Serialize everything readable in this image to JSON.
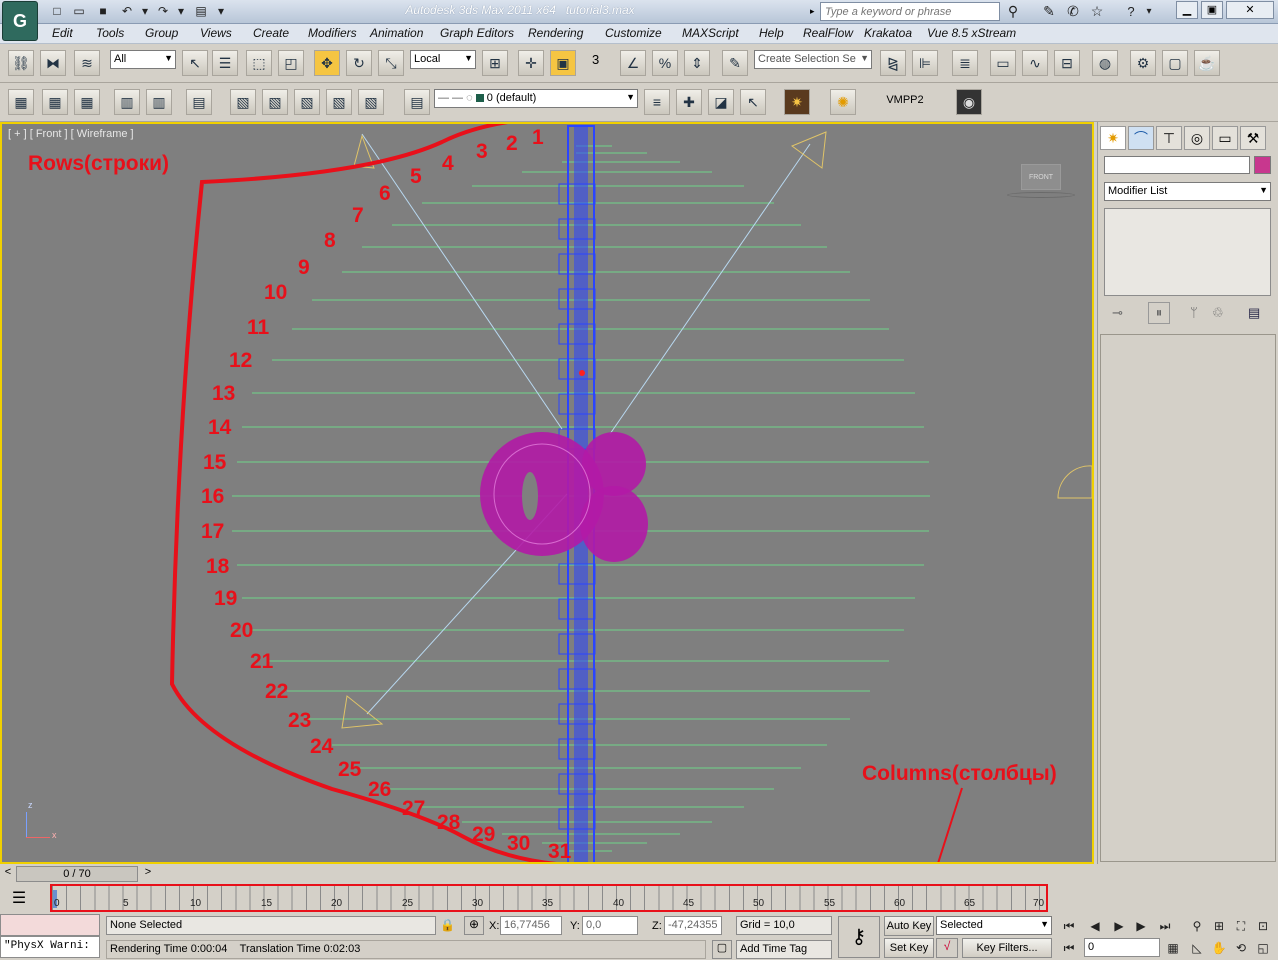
{
  "title": {
    "app": "Autodesk 3ds Max  2011 x64",
    "file": "tutorial3.max",
    "logo_glyph": "G"
  },
  "search": {
    "placeholder": "Type a keyword or phrase"
  },
  "menus": [
    "Edit",
    "Tools",
    "Group",
    "Views",
    "Create",
    "Modifiers",
    "Animation",
    "Graph Editors",
    "Rendering",
    "Customize",
    "MAXScript",
    "Help",
    "RealFlow",
    "Krakatoa",
    "Vue 8.5 xStream"
  ],
  "toolbar": {
    "filter": "All",
    "coord_system": "Local",
    "selection_set_placeholder": "Create Selection Se",
    "snap_number": "3",
    "layer": "0 (default)",
    "vmpp_label": "VMPP2"
  },
  "viewport": {
    "label": "[ + ] [ Front ] [ Wireframe ]",
    "viewcube_label": "FRONT",
    "axis_z": "z",
    "axis_x": "x",
    "annotation_rows": "Rows(строки)",
    "annotation_columns": "Columns(столбцы)",
    "row_numbers": [
      "1",
      "2",
      "3",
      "4",
      "5",
      "6",
      "7",
      "8",
      "9",
      "10",
      "11",
      "12",
      "13",
      "14",
      "15",
      "16",
      "17",
      "18",
      "19",
      "20",
      "21",
      "22",
      "23",
      "24",
      "25",
      "26",
      "27",
      "28",
      "29",
      "30",
      "31"
    ]
  },
  "command_panel": {
    "modifier_list": "Modifier List"
  },
  "timeline": {
    "frame_counter": "0 / 70",
    "prev": "<",
    "next": ">",
    "ticks": [
      "0",
      "5",
      "10",
      "15",
      "20",
      "25",
      "30",
      "35",
      "40",
      "45",
      "50",
      "55",
      "60",
      "65",
      "70"
    ]
  },
  "status": {
    "maxscript_listener": "\"PhysX Warni:",
    "selection": "None Selected",
    "rendering_time": "Rendering Time  0:00:04",
    "translation_time": "Translation Time  0:02:03",
    "x_label": "X:",
    "x_value": "16,77456",
    "y_label": "Y:",
    "y_value": "0,0",
    "z_label": "Z:",
    "z_value": "-47,24355",
    "grid": "Grid = 10,0",
    "add_time_tag": "Add Time Tag",
    "auto_key": "Auto Key",
    "set_key": "Set Key",
    "key_mode": "Selected",
    "key_filters": "Key Filters...",
    "current_frame": "0"
  },
  "colors": {
    "annotation": "#e8101a",
    "grid_lines": "#6fd48a",
    "camera": "#e0c468",
    "mesh": "#b21aa6",
    "object": "#2b45ff",
    "viewport_border": "#f0d000"
  }
}
